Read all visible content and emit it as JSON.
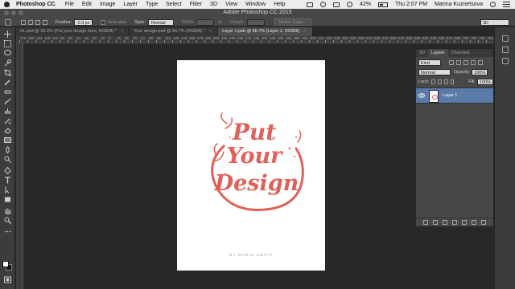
{
  "menubar": {
    "app_name": "Photoshop CC",
    "items": [
      "File",
      "Edit",
      "Image",
      "Layer",
      "Type",
      "Select",
      "Filter",
      "3D",
      "View",
      "Window",
      "Help"
    ],
    "battery": "42%",
    "clock": "Thu 2:07 PM",
    "user": "Marina Kuznetsova"
  },
  "window": {
    "title": "Adobe Photoshop CC 2015"
  },
  "options": {
    "feather_label": "Feather:",
    "feather_value": "0.3 px",
    "anti_alias_label": "Anti-alias",
    "style_label": "Style:",
    "style_value": "Normal",
    "width_label": "Width:",
    "height_label": "Height:",
    "refine_edge_label": "Refine Edge...",
    "workspace_value": "3D"
  },
  "tabs": [
    {
      "label": "01.psd @ 33.3% (Put your design here, RGB/8) *",
      "active": false
    },
    {
      "label": "Your design.psd @ 66.7% (RGB/8) *",
      "active": false
    },
    {
      "label": "Layer 1.psb @ 66.7% (Layer 1, RGB/8)",
      "active": true
    }
  ],
  "ruler": {
    "labels": [
      "172",
      "160",
      "144",
      "128",
      "112",
      "96",
      "80",
      "64",
      "48",
      "32",
      "16",
      "0",
      "16",
      "32",
      "48",
      "64",
      "80",
      "96",
      "112",
      "128",
      "144",
      "160",
      "176",
      "192",
      "208",
      "224",
      "240",
      "256",
      "272",
      "288",
      "304",
      "320",
      "336",
      "352",
      "368",
      "384",
      "400",
      "416",
      "432",
      "448",
      "464",
      "480",
      "496",
      "512",
      "528",
      "544",
      "560",
      "576",
      "592",
      "608",
      "624",
      "640",
      "656",
      "672",
      "688",
      "700",
      "720",
      "736",
      "752"
    ]
  },
  "artwork": {
    "line1": "Put",
    "line2": "Your",
    "line3": "Design",
    "credit": "BY MARIE SMITH",
    "accent_color": "#e0615a"
  },
  "layers_panel": {
    "tabs": [
      "3D",
      "Layers",
      "Channels"
    ],
    "kind_label": "Kind",
    "blend_mode": "Normal",
    "opacity_label": "Opacity:",
    "opacity_value": "100%",
    "lock_label": "Lock:",
    "fill_label": "Fill:",
    "fill_value": "100%",
    "layer_name": "Layer 1"
  }
}
